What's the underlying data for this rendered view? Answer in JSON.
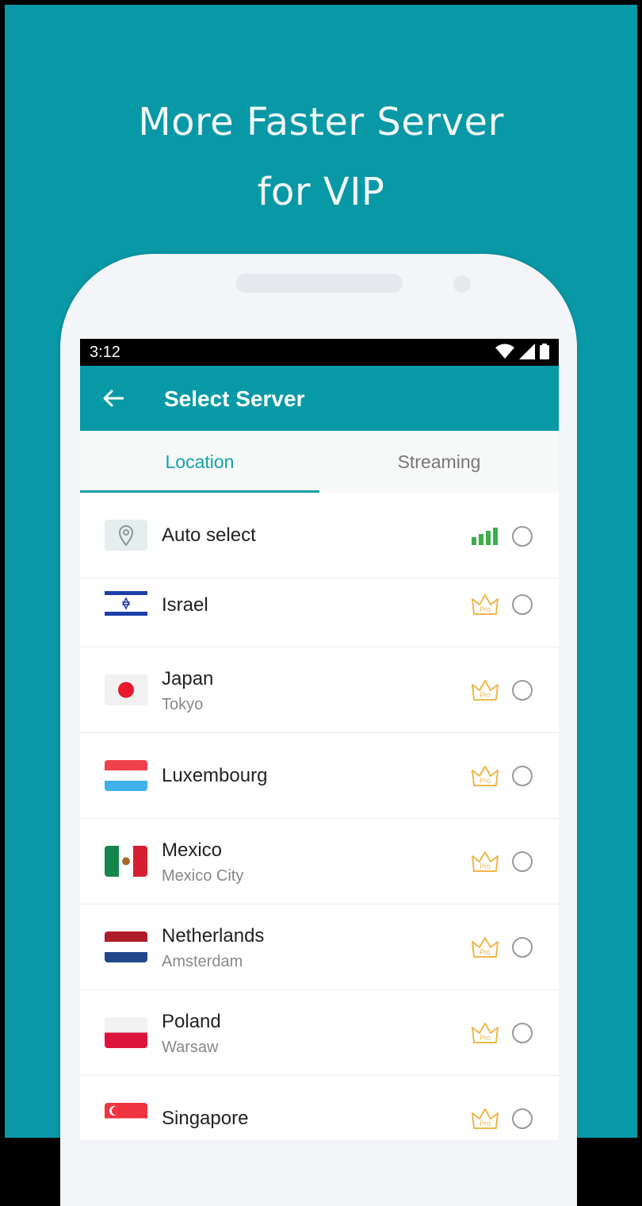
{
  "promo": {
    "line1": "More Faster Server",
    "line2": "for VIP"
  },
  "status_bar": {
    "time": "3:12"
  },
  "app_bar": {
    "title": "Select Server"
  },
  "tabs": [
    {
      "label": "Location",
      "active": true
    },
    {
      "label": "Streaming",
      "active": false
    }
  ],
  "servers": [
    {
      "name": "Auto select",
      "city": "",
      "flag": "location-pin-icon",
      "badge": "signal-bars-icon",
      "selected": false
    },
    {
      "name": "Israel",
      "city": "",
      "flag": "israel-flag-icon",
      "badge": "pro-crown-icon",
      "badge_text": "Pro",
      "selected": false
    },
    {
      "name": "Japan",
      "city": "Tokyo",
      "flag": "japan-flag-icon",
      "badge": "pro-crown-icon",
      "badge_text": "Pro",
      "selected": false
    },
    {
      "name": "Luxembourg",
      "city": "",
      "flag": "luxembourg-flag-icon",
      "badge": "pro-crown-icon",
      "badge_text": "Pro",
      "selected": false
    },
    {
      "name": "Mexico",
      "city": "Mexico City",
      "flag": "mexico-flag-icon",
      "badge": "pro-crown-icon",
      "badge_text": "Pro",
      "selected": false
    },
    {
      "name": "Netherlands",
      "city": "Amsterdam",
      "flag": "netherlands-flag-icon",
      "badge": "pro-crown-icon",
      "badge_text": "Pro",
      "selected": false
    },
    {
      "name": "Poland",
      "city": "Warsaw",
      "flag": "poland-flag-icon",
      "badge": "pro-crown-icon",
      "badge_text": "Pro",
      "selected": false
    },
    {
      "name": "Singapore",
      "city": "",
      "flag": "singapore-flag-icon",
      "badge": "pro-crown-icon",
      "badge_text": "Pro",
      "selected": false
    }
  ],
  "colors": {
    "background": "#0898a6",
    "app_bar": "#079aa6",
    "accent": "#16a0a9",
    "signal": "#3cae4a",
    "crown": "#f0b64a"
  }
}
